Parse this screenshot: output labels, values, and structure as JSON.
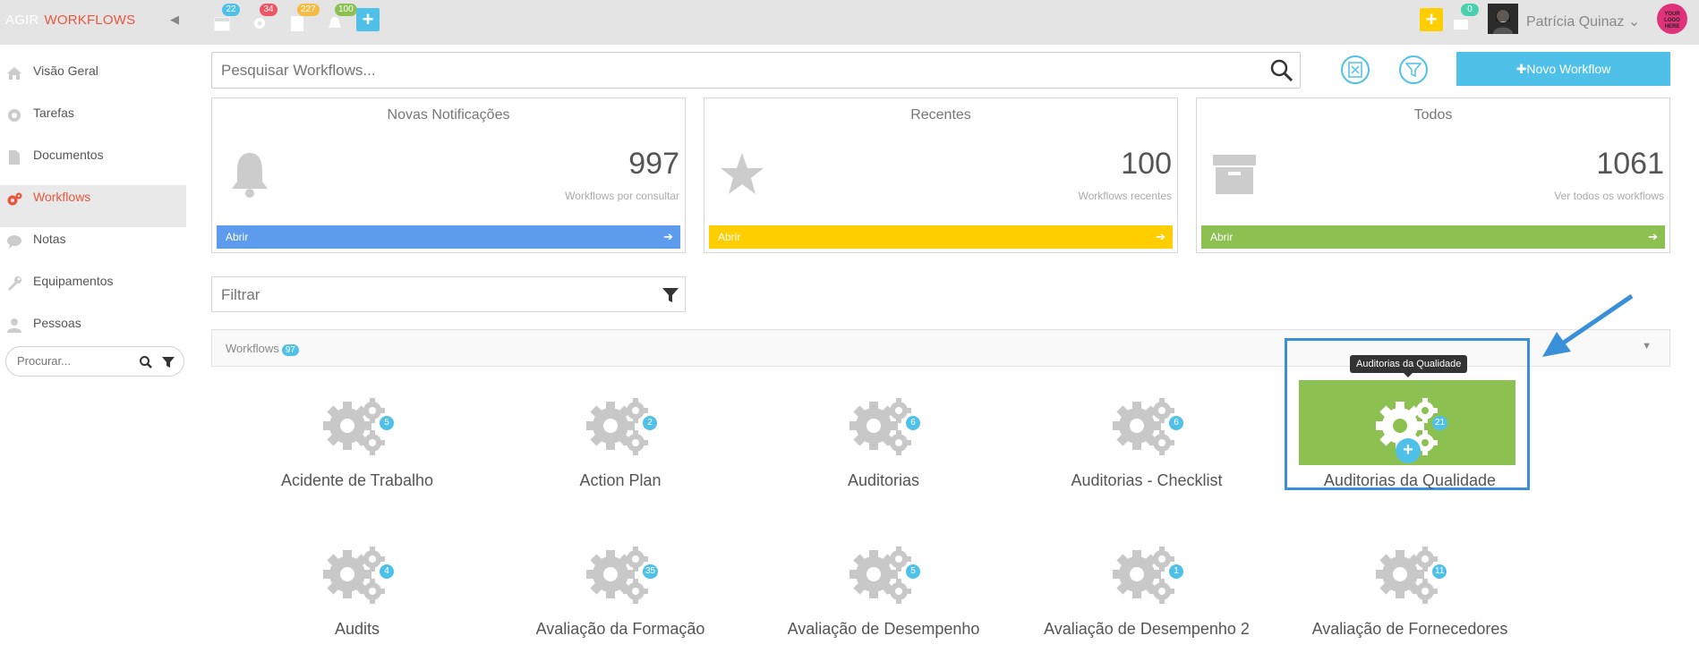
{
  "app": {
    "brand": "AGIR",
    "module": "WORKFLOWS"
  },
  "topbar": {
    "badges": {
      "calendar": "22",
      "tasks": "34",
      "documents": "227",
      "notifications": "100",
      "messages": "0"
    },
    "user_name": "Patrícia Quinaz",
    "logo_text": "YOUR LOGO HERE"
  },
  "sidebar": {
    "items": [
      {
        "label": "Visão Geral",
        "icon": "home-icon"
      },
      {
        "label": "Tarefas",
        "icon": "gear-icon"
      },
      {
        "label": "Documentos",
        "icon": "document-icon"
      },
      {
        "label": "Workflows",
        "icon": "gears-icon",
        "active": true
      },
      {
        "label": "Notas",
        "icon": "chat-icon"
      },
      {
        "label": "Equipamentos",
        "icon": "wrench-icon"
      },
      {
        "label": "Pessoas",
        "icon": "user-icon"
      }
    ],
    "search_placeholder": "Procurar..."
  },
  "main": {
    "search_placeholder": "Pesquisar Workflows...",
    "new_button": "Novo Workflow",
    "cards": [
      {
        "title": "Novas Notificações",
        "number": "997",
        "subtitle": "Workflows por consultar",
        "footer": "Abrir",
        "color": "#5d9cec"
      },
      {
        "title": "Recentes",
        "number": "100",
        "subtitle": "Workflows recentes",
        "footer": "Abrir",
        "color": "#ffce00"
      },
      {
        "title": "Todos",
        "number": "1061",
        "subtitle": "Ver todos os workflows",
        "footer": "Abrir",
        "color": "#8cc152"
      }
    ],
    "filter_placeholder": "Filtrar",
    "workflows_label": "Workflows",
    "workflows_count": "97",
    "tooltip": "Auditorias da Qualidade",
    "tiles": [
      {
        "label": "Acidente de Trabalho",
        "count": "5"
      },
      {
        "label": "Action Plan",
        "count": "2"
      },
      {
        "label": "Auditorias",
        "count": "6"
      },
      {
        "label": "Auditorias - Checklist",
        "count": "6"
      },
      {
        "label": "Auditorias da Qualidade",
        "count": "21"
      },
      {
        "label": "Audits",
        "count": "4"
      },
      {
        "label": "Avaliação da Formação",
        "count": "35"
      },
      {
        "label": "Avaliação de Desempenho",
        "count": "5"
      },
      {
        "label": "Avaliação de Desempenho 2",
        "count": "1"
      },
      {
        "label": "Avaliação de Fornecedores",
        "count": "11"
      }
    ]
  },
  "colors": {
    "accent": "#4fc1e9",
    "brand": "#e9573f",
    "highlight": "#3a8fd9",
    "active_tile": "#8cc152"
  }
}
